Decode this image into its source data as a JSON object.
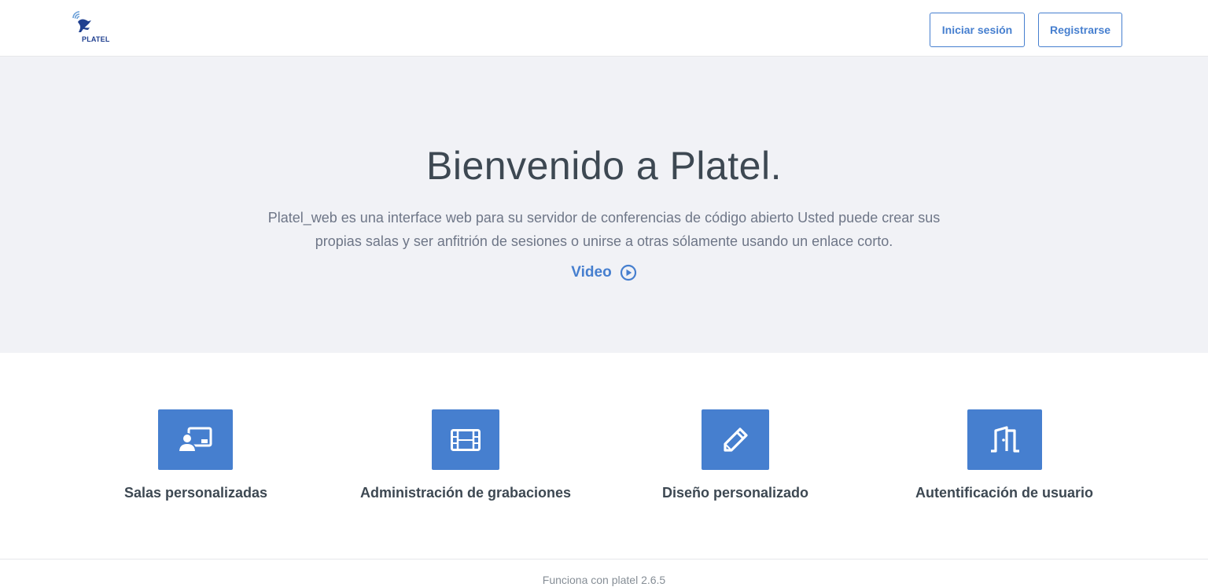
{
  "header": {
    "logo_text": "PLATEL",
    "login_label": "Iniciar sesión",
    "register_label": "Registrarse"
  },
  "hero": {
    "title": "Bienvenido a Platel.",
    "description": "Platel_web es una interface web para su servidor de conferencias de código abierto Usted puede crear sus propias salas y ser anfitrión de sesiones o unirse a otras sólamente usando un enlace corto.",
    "video_label": "Video"
  },
  "features": [
    {
      "label": "Salas personalizadas",
      "icon": "presentation-user-icon"
    },
    {
      "label": "Administración de grabaciones",
      "icon": "film-icon"
    },
    {
      "label": "Diseño personalizado",
      "icon": "pencil-icon"
    },
    {
      "label": "Autentificación de usuario",
      "icon": "door-open-icon"
    }
  ],
  "footer": {
    "text": "Funciona con platel 2.6.5"
  },
  "colors": {
    "accent": "#467fcf",
    "hero_bg": "#f1f2f6",
    "title": "#3d4852"
  }
}
